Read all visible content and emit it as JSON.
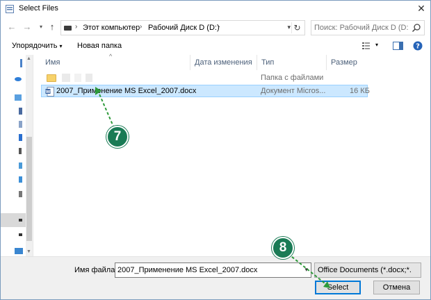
{
  "window": {
    "title": "Select Files"
  },
  "nav": {
    "back_icon": "back-arrow-icon",
    "forward_icon": "forward-arrow-icon",
    "recent_icon": "chevron-down-icon",
    "up_icon": "up-arrow-icon",
    "breadcrumb": [
      "Этот компьютер",
      "Рабочий Диск D (D:)"
    ],
    "search_placeholder": "Поиск: Рабочий Диск D (D:)"
  },
  "toolbar": {
    "organize_label": "Упорядочить",
    "new_folder_label": "Новая папка"
  },
  "columns": {
    "name": "Имя",
    "date_modified": "Дата изменения",
    "type": "Тип",
    "size": "Размер"
  },
  "files": [
    {
      "name": "",
      "type": "Папка с файлами",
      "size": "",
      "kind": "folder",
      "selected": false
    },
    {
      "name": "2007_Применение MS Excel_2007.docx",
      "type": "Документ Micros...",
      "size": "16 КБ",
      "kind": "word-document",
      "selected": true
    }
  ],
  "bottom": {
    "filename_label": "Имя файла:",
    "filename_value": "2007_Применение MS Excel_2007.docx",
    "filter_value": "Office Documents (*.docx;*.doc",
    "select_label": "Select",
    "cancel_label": "Отмена"
  },
  "callouts": [
    {
      "label": "7"
    },
    {
      "label": "8"
    }
  ],
  "colors": {
    "callout": "#1a7b55",
    "callout_line": "#2e9a3a",
    "selection": "#cce8ff",
    "accent": "#0078d7"
  }
}
